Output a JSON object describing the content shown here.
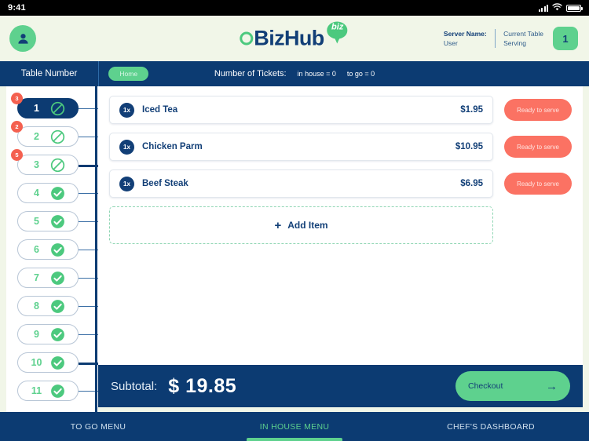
{
  "statusbar": {
    "time": "9:41",
    "icons": [
      "signal-icon",
      "wifi-icon",
      "battery-icon"
    ]
  },
  "header": {
    "avatar_icon": "user-avatar-icon",
    "logo": {
      "mark": "circle-o-mark",
      "text": "BizHub",
      "pin_text": "biz",
      "pin_icon": "map-pin-icon"
    },
    "server_label": "Server Name:",
    "server_value": "User",
    "current_table_label": "Current Table",
    "current_table_sub": "Serving",
    "current_table_number": "1"
  },
  "navstrip": {
    "table_number_label": "Table Number",
    "home_label": "Home",
    "tickets_title": "Number of Tickets:",
    "tickets_in_house": "in house = 0",
    "tickets_to_go": "to go = 0"
  },
  "sidebar": {
    "tables": [
      {
        "number": "1",
        "status": "blocked",
        "badge": "3",
        "selected": true,
        "connector": "thin"
      },
      {
        "number": "2",
        "status": "blocked",
        "badge": "2",
        "selected": false,
        "connector": "thin"
      },
      {
        "number": "3",
        "status": "blocked",
        "badge": "5",
        "selected": false,
        "connector": "thick"
      },
      {
        "number": "4",
        "status": "available",
        "badge": "",
        "selected": false,
        "connector": "thin"
      },
      {
        "number": "5",
        "status": "available",
        "badge": "",
        "selected": false,
        "connector": "thin"
      },
      {
        "number": "6",
        "status": "available",
        "badge": "",
        "selected": false,
        "connector": "thin"
      },
      {
        "number": "7",
        "status": "available",
        "badge": "",
        "selected": false,
        "connector": "thin"
      },
      {
        "number": "8",
        "status": "available",
        "badge": "",
        "selected": false,
        "connector": "thin"
      },
      {
        "number": "9",
        "status": "available",
        "badge": "",
        "selected": false,
        "connector": "thin"
      },
      {
        "number": "10",
        "status": "available",
        "badge": "",
        "selected": false,
        "connector": "thick"
      },
      {
        "number": "11",
        "status": "available",
        "badge": "",
        "selected": false,
        "connector": "thin"
      }
    ]
  },
  "order": {
    "items": [
      {
        "qty": "1x",
        "name": "Iced Tea",
        "price": "$1.95",
        "action": "Ready to serve"
      },
      {
        "qty": "1x",
        "name": "Chicken Parm",
        "price": "$10.95",
        "action": "Ready to serve"
      },
      {
        "qty": "1x",
        "name": "Beef Steak",
        "price": "$6.95",
        "action": "Ready to serve"
      }
    ],
    "add_item_plus": "+",
    "add_item_label": "Add Item"
  },
  "subtotal": {
    "label": "Subtotal:",
    "value": "$ 19.85",
    "checkout_label": "Checkout",
    "checkout_arrow": "→"
  },
  "tabbar": {
    "tabs": [
      {
        "label": "TO GO MENU",
        "active": false
      },
      {
        "label": "IN HOUSE MENU",
        "active": true
      },
      {
        "label": "CHEF'S DASHBOARD",
        "active": false
      }
    ]
  },
  "colors": {
    "navy": "#0c3b72",
    "deep_navy": "#123f77",
    "green": "#5ed18e",
    "green_accent": "#4cc97e",
    "coral": "#fb7263",
    "badge_red": "#f4604f",
    "cream": "#f1f6e8"
  }
}
